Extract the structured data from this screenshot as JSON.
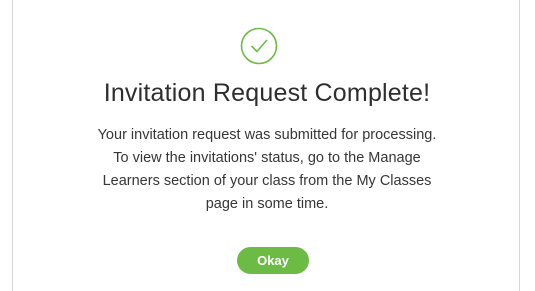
{
  "dialog": {
    "icon": "checkmark-circle-icon",
    "accent_color": "#6cbb45",
    "title": "Invitation Request Complete!",
    "message_lines": [
      "Your invitation request was submitted for processing.",
      "To view the invitations' status, go to the Manage",
      "Learners section of your class from the My Classes",
      "page in some time."
    ],
    "okay_label": "Okay"
  }
}
